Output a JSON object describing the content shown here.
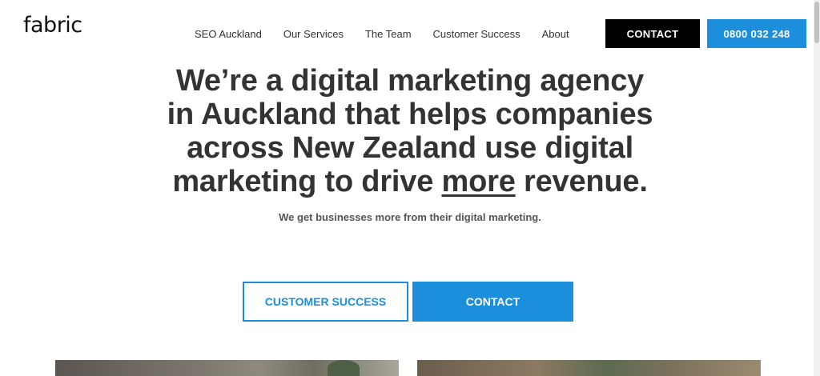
{
  "header": {
    "logo": "fabric",
    "nav": [
      "SEO Auckland",
      "Our Services",
      "The Team",
      "Customer Success",
      "About"
    ],
    "contact_button": "CONTACT",
    "phone_button": "0800 032 248"
  },
  "hero": {
    "title_line1": "We’re a digital marketing agency",
    "title_line2": "in Auckland that helps companies",
    "title_line3": "across New Zealand use digital",
    "title_line4_pre": "marketing to drive ",
    "title_line4_emph": "more",
    "title_line4_post": " revenue.",
    "subtitle": "We get businesses more from their digital marketing.",
    "primary_button": "CUSTOMER SUCCESS",
    "secondary_button": "CONTACT"
  },
  "colors": {
    "accent": "#1b8fdc",
    "dark": "#000000",
    "text": "#333333"
  }
}
